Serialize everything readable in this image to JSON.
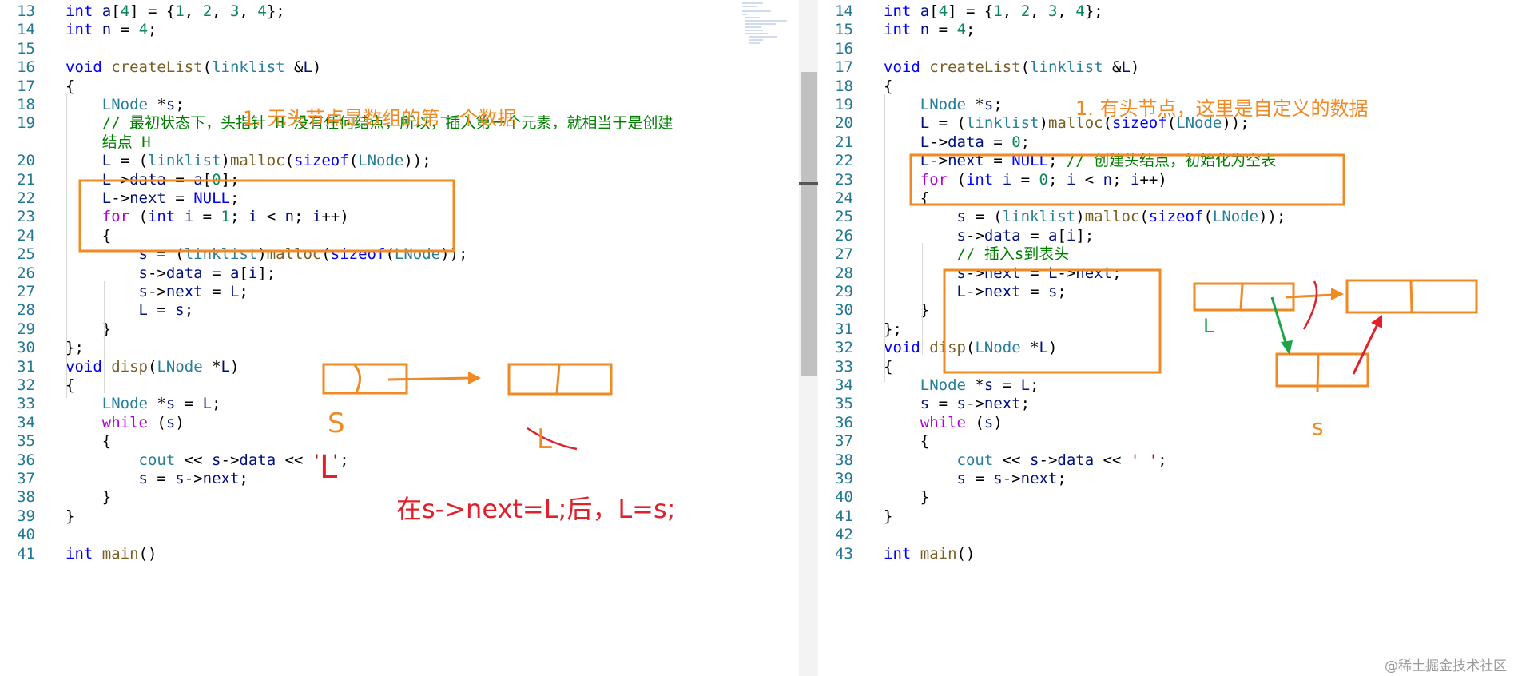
{
  "left_editor": {
    "lines": [
      {
        "n": "13",
        "text": "int a[4] = {1, 2, 3, 4};"
      },
      {
        "n": "14",
        "text": "int n = 4;"
      },
      {
        "n": "15",
        "text": ""
      },
      {
        "n": "16",
        "text": "void createList(linklist &L)"
      },
      {
        "n": "17",
        "text": "{"
      },
      {
        "n": "18",
        "text": "    LNode *s;"
      },
      {
        "n": "19",
        "text": "    // 最初状态下，头指针 H 没有任何结点，所以，插入第一个元素，就相当于是创建"
      },
      {
        "n": "",
        "text": "    结点 H"
      },
      {
        "n": "20",
        "text": "    L = (linklist)malloc(sizeof(LNode));"
      },
      {
        "n": "21",
        "text": "    L->data = a[0];"
      },
      {
        "n": "22",
        "text": "    L->next = NULL;"
      },
      {
        "n": "23",
        "text": "    for (int i = 1; i < n; i++)"
      },
      {
        "n": "24",
        "text": "    {"
      },
      {
        "n": "25",
        "text": "        s = (linklist)malloc(sizeof(LNode));"
      },
      {
        "n": "26",
        "text": "        s->data = a[i];"
      },
      {
        "n": "27",
        "text": "        s->next = L;"
      },
      {
        "n": "28",
        "text": "        L = s;"
      },
      {
        "n": "29",
        "text": "    }"
      },
      {
        "n": "30",
        "text": "};"
      },
      {
        "n": "31",
        "text": "void disp(LNode *L)"
      },
      {
        "n": "32",
        "text": "{"
      },
      {
        "n": "33",
        "text": "    LNode *s = L;"
      },
      {
        "n": "34",
        "text": "    while (s)"
      },
      {
        "n": "35",
        "text": "    {"
      },
      {
        "n": "36",
        "text": "        cout << s->data << ' ';"
      },
      {
        "n": "37",
        "text": "        s = s->next;"
      },
      {
        "n": "38",
        "text": "    }"
      },
      {
        "n": "39",
        "text": "}"
      },
      {
        "n": "40",
        "text": ""
      },
      {
        "n": "41",
        "text": "int main()"
      }
    ],
    "annotations": {
      "heading": "1. 无头节点是数组的第一个数据",
      "label_s": "S",
      "label_l_red": "L",
      "label_l_struck": "L",
      "note": "在s->next=L;后，L=s;"
    }
  },
  "right_editor": {
    "lines": [
      {
        "n": "14",
        "text": "int a[4] = {1, 2, 3, 4};"
      },
      {
        "n": "15",
        "text": "int n = 4;"
      },
      {
        "n": "16",
        "text": ""
      },
      {
        "n": "17",
        "text": "void createList(linklist &L)"
      },
      {
        "n": "18",
        "text": "{"
      },
      {
        "n": "19",
        "text": "    LNode *s;"
      },
      {
        "n": "20",
        "text": "    L = (linklist)malloc(sizeof(LNode));"
      },
      {
        "n": "21",
        "text": "    L->data = 0;"
      },
      {
        "n": "22",
        "text": "    L->next = NULL; // 创建头结点，初始化为空表"
      },
      {
        "n": "23",
        "text": "    for (int i = 0; i < n; i++)"
      },
      {
        "n": "24",
        "text": "    {"
      },
      {
        "n": "25",
        "text": "        s = (linklist)malloc(sizeof(LNode));"
      },
      {
        "n": "26",
        "text": "        s->data = a[i];"
      },
      {
        "n": "27",
        "text": "        // 插入s到表头"
      },
      {
        "n": "28",
        "text": "        s->next = L->next;"
      },
      {
        "n": "29",
        "text": "        L->next = s;"
      },
      {
        "n": "30",
        "text": "    }"
      },
      {
        "n": "31",
        "text": "};"
      },
      {
        "n": "32",
        "text": "void disp(LNode *L)"
      },
      {
        "n": "33",
        "text": "{"
      },
      {
        "n": "34",
        "text": "    LNode *s = L;"
      },
      {
        "n": "35",
        "text": "    s = s->next;"
      },
      {
        "n": "36",
        "text": "    while (s)"
      },
      {
        "n": "37",
        "text": "    {"
      },
      {
        "n": "38",
        "text": "        cout << s->data << ' ';"
      },
      {
        "n": "39",
        "text": "        s = s->next;"
      },
      {
        "n": "40",
        "text": "    }"
      },
      {
        "n": "41",
        "text": "}"
      },
      {
        "n": "42",
        "text": ""
      },
      {
        "n": "43",
        "text": "int main()"
      }
    ],
    "annotations": {
      "heading": "1. 有头节点，这里是自定义的数据",
      "label_l": "L",
      "label_s": "s"
    }
  },
  "watermark": "@稀土掘金技术社区",
  "colors": {
    "keyword": "#0000ff",
    "control": "#af00db",
    "type": "#267f99",
    "function": "#795e26",
    "comment": "#008000",
    "number": "#098658",
    "string": "#a31515",
    "line_number": "#237893",
    "annotation_orange": "#f08a24",
    "annotation_red": "#e0202a",
    "annotation_green": "#1aa646"
  },
  "icons": [
    "scrollbar-thumb",
    "minimap"
  ]
}
